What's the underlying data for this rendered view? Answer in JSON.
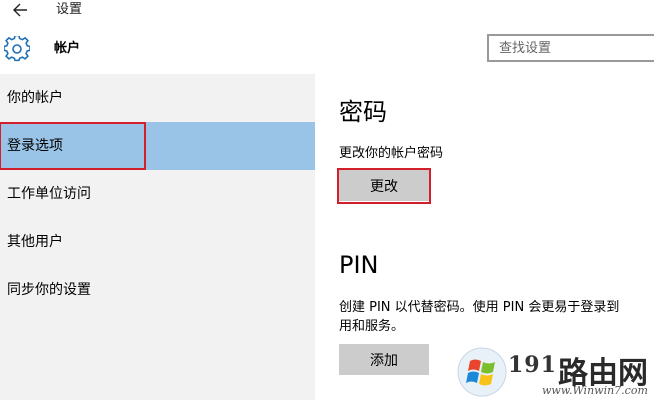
{
  "titlebar": {
    "back_icon": "back-arrow-icon",
    "app_title": "设置"
  },
  "header": {
    "icon": "gear-icon",
    "page_title": "帐户",
    "search_placeholder": "查找设置"
  },
  "sidebar": {
    "items": [
      {
        "label": "你的帐户",
        "selected": false
      },
      {
        "label": "登录选项",
        "selected": true
      },
      {
        "label": "工作单位访问",
        "selected": false
      },
      {
        "label": "其他用户",
        "selected": false
      },
      {
        "label": "同步你的设置",
        "selected": false
      }
    ],
    "selected_color": "#99c4e8",
    "highlight_color": "#d21f2b"
  },
  "content": {
    "password": {
      "heading": "密码",
      "description": "更改你的帐户密码",
      "button": "更改"
    },
    "pin": {
      "heading": "PIN",
      "description_line1": "创建 PIN 以代替密码。使用 PIN 会更易于登录到",
      "description_line2": "用和服务。",
      "button": "添加"
    }
  },
  "watermark": {
    "logo_icon": "windows-logo-icon",
    "number": "191",
    "brand": "路由网",
    "url": "www.Winwin7.com"
  }
}
